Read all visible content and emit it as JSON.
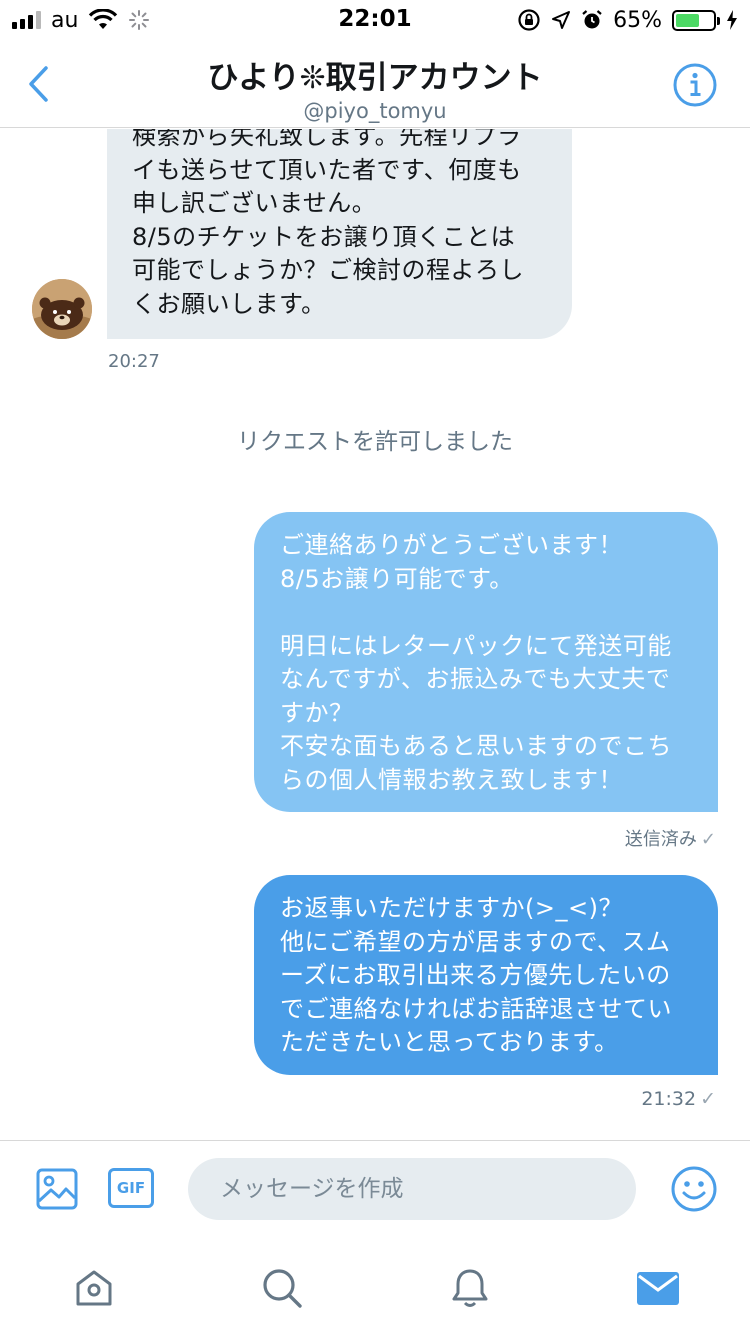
{
  "status_bar": {
    "carrier": "au",
    "time": "22:01",
    "battery_percent": "65%",
    "battery_level": 0.65,
    "icons": [
      "signal-icon",
      "wifi-icon",
      "loading-icon",
      "orientation-lock-icon",
      "location-icon",
      "alarm-icon",
      "battery-icon",
      "charging-icon"
    ]
  },
  "header": {
    "title": "ひより❊取引アカウント",
    "handle": "@piyo_tomyu",
    "back_icon": "chevron-left-icon",
    "info_icon": "info-icon"
  },
  "messages": [
    {
      "direction": "incoming",
      "text": "検索から失礼致します。先程リプラ\nイも送らせて頂いた者です、何度も\n申し訳ございません。\n8/5のチケットをお譲り頂くことは\n可能でしょうか？ご検討の程よろし\nくお願いします。",
      "timestamp": "20:27"
    },
    {
      "direction": "system",
      "text": "リクエストを許可しました"
    },
    {
      "direction": "outgoing",
      "text": "ご連絡ありがとうございます！\n8/5お譲り可能です。\n\n明日にはレターパックにて発送可能\nなんですが、お振込みでも大丈夫で\nすか？\n不安な面もあると思いますのでこち\nらの個人情報お教え致します！",
      "status": "送信済み",
      "status_icon": "check-icon"
    },
    {
      "direction": "outgoing",
      "text": "お返事いただけますか(>_<)？\n他にご希望の方が居ますので、スム\nーズにお取引出来る方優先したいの\nでご連絡なければお話辞退させてい\nただきたいと思っております。",
      "timestamp": "21:32",
      "status_icon": "check-icon"
    }
  ],
  "composer": {
    "placeholder": "メッセージを作成",
    "gif_label": "GIF",
    "media_icon": "image-icon",
    "emoji_icon": "smiley-icon"
  },
  "tabbar": {
    "tabs": [
      "home-icon",
      "search-icon",
      "notifications-icon",
      "messages-icon"
    ],
    "active": "messages-icon"
  },
  "colors": {
    "accent": "#4a9ee8",
    "outgoing_sent": "#85c4f3",
    "outgoing": "#4a9ee8",
    "incoming": "#e6ecf0",
    "muted_text": "#657786"
  }
}
